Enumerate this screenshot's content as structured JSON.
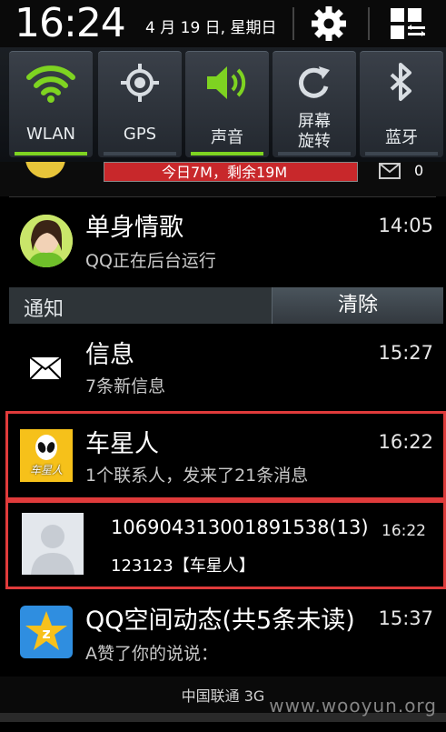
{
  "status_bar": {
    "time": "16:24",
    "date": "4 月 19 日, 星期日",
    "settings_icon": "gear-icon",
    "more_icon": "grid-menu-icon"
  },
  "toggles": [
    {
      "label": "WLAN",
      "icon": "wifi-icon",
      "on": true
    },
    {
      "label": "GPS",
      "icon": "gps-icon",
      "on": false
    },
    {
      "label": "声音",
      "icon": "speaker-icon",
      "on": true
    },
    {
      "label": "屏幕\n旋转",
      "icon": "rotate-icon",
      "on": false
    },
    {
      "label": "蓝牙",
      "icon": "bluetooth-icon",
      "on": false
    }
  ],
  "usage": {
    "text": "今日7M，剩余19M",
    "mail_count": "0"
  },
  "ongoing": {
    "title": "单身情歌",
    "time": "14:05",
    "subtitle": "QQ正在后台运行"
  },
  "notification_section": {
    "title": "通知",
    "clear_label": "清除"
  },
  "notifications": [
    {
      "title": "信息",
      "time": "15:27",
      "subtitle": "7条新信息"
    },
    {
      "title": "车星人",
      "time": "16:22",
      "subtitle": "1个联系人，发来了21条消息",
      "icon_text": "车星人"
    },
    {
      "title": "106904313001891538(13)",
      "time": "16:22",
      "subtitle": "123123【车星人】"
    },
    {
      "title": "QQ空间动态(共5条未读)",
      "time": "15:37",
      "subtitle": "A赞了你的说说："
    }
  ],
  "carrier": "中国联通 3G",
  "watermark": "www.wooyun.org",
  "colors": {
    "accent_on": "#7ed321",
    "highlight_border": "#e03b3b",
    "usage_bar": "#c8282b"
  }
}
